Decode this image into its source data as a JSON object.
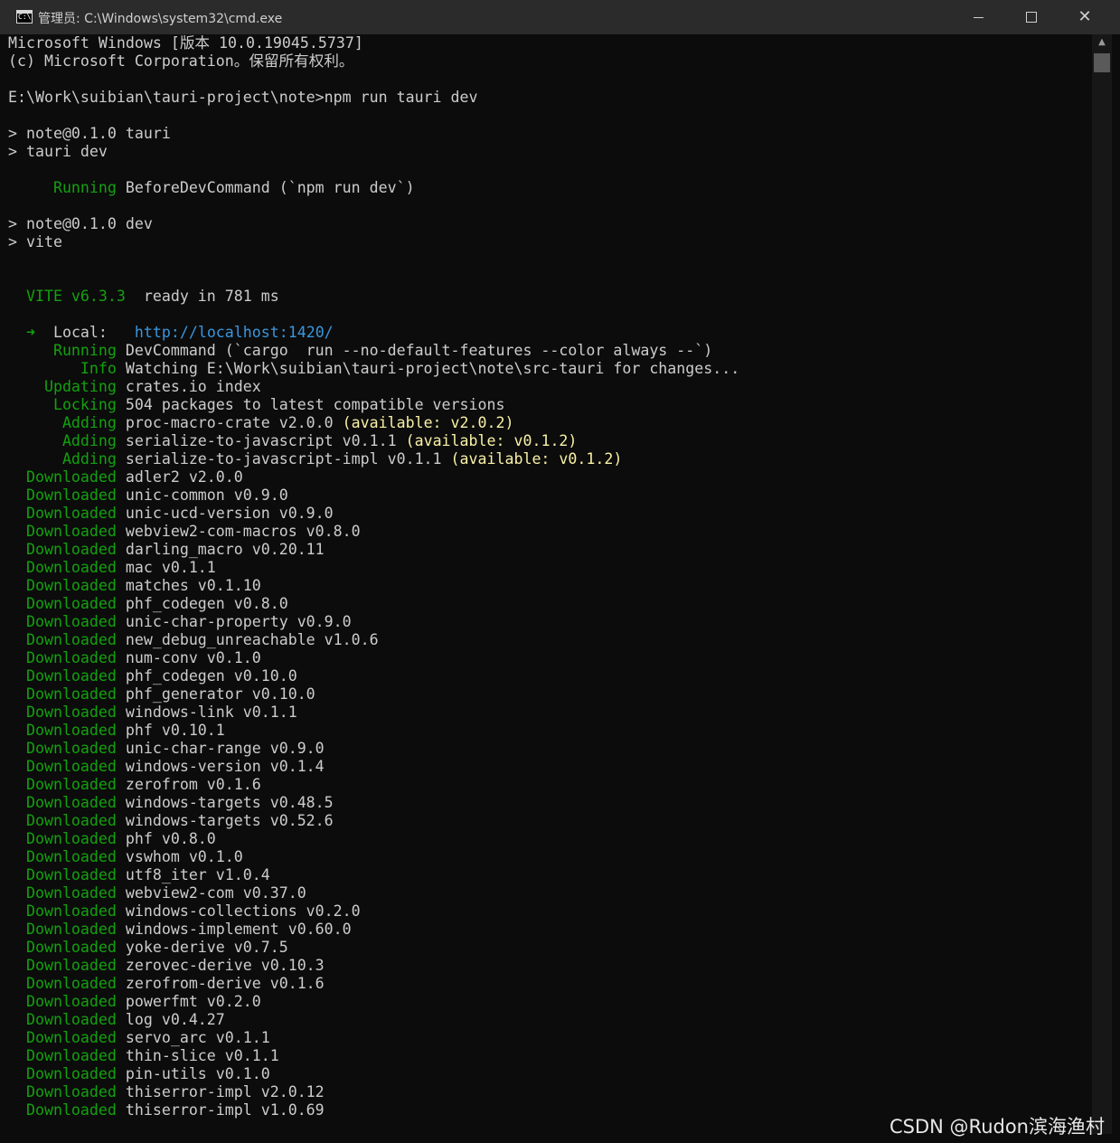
{
  "window": {
    "title": "管理员: C:\\Windows\\system32\\cmd.exe",
    "icon": "cmd-icon",
    "icon_glyph": "C:\\",
    "controls": {
      "minimize": "minimize-icon",
      "maximize": "maximize-icon",
      "close": "close-icon",
      "close_glyph": "✕"
    }
  },
  "colors": {
    "background": "#0c0c0c",
    "text": "#cccccc",
    "green": "#13a10e",
    "yellow": "#f9f1a5",
    "blue": "#3a96dd",
    "titlebar": "#2b2b2b"
  },
  "console": {
    "lines": [
      [
        {
          "t": "Microsoft Windows [版本 10.0.19045.5737]",
          "c": "w"
        }
      ],
      [
        {
          "t": "(c) Microsoft Corporation。保留所有权利。",
          "c": "w"
        }
      ],
      [],
      [
        {
          "t": "E:\\Work\\suibian\\tauri-project\\note>npm run tauri dev",
          "c": "w"
        }
      ],
      [],
      [
        {
          "t": "> note@0.1.0 tauri",
          "c": "w"
        }
      ],
      [
        {
          "t": "> tauri dev",
          "c": "w"
        }
      ],
      [],
      [
        {
          "t": "     Running",
          "c": "g"
        },
        {
          "t": " BeforeDevCommand (`npm run dev`)",
          "c": "w"
        }
      ],
      [],
      [
        {
          "t": "> note@0.1.0 dev",
          "c": "w"
        }
      ],
      [
        {
          "t": "> vite",
          "c": "w"
        }
      ],
      [],
      [],
      [
        {
          "t": "  VITE v6.3.3",
          "c": "g"
        },
        {
          "t": "  ready in ",
          "c": "w"
        },
        {
          "t": "781",
          "c": "w"
        },
        {
          "t": " ms",
          "c": "w"
        }
      ],
      [],
      [
        {
          "t": "  ➜",
          "c": "g"
        },
        {
          "t": "  Local:   ",
          "c": "w"
        },
        {
          "t": "http://localhost:1420/",
          "c": "b"
        }
      ],
      [
        {
          "t": "     Running",
          "c": "g"
        },
        {
          "t": " DevCommand (`cargo  run --no-default-features --color always --`)",
          "c": "w"
        }
      ],
      [
        {
          "t": "        Info",
          "c": "g"
        },
        {
          "t": " Watching E:\\Work\\suibian\\tauri-project\\note\\src-tauri for changes...",
          "c": "w"
        }
      ],
      [
        {
          "t": "    Updating",
          "c": "g"
        },
        {
          "t": " crates.io index",
          "c": "w"
        }
      ],
      [
        {
          "t": "     Locking",
          "c": "g"
        },
        {
          "t": " 504 packages to latest compatible versions",
          "c": "w"
        }
      ],
      [
        {
          "t": "      Adding",
          "c": "g"
        },
        {
          "t": " proc-macro-crate v2.0.0 ",
          "c": "w"
        },
        {
          "t": "(available: v2.0.2)",
          "c": "y"
        }
      ],
      [
        {
          "t": "      Adding",
          "c": "g"
        },
        {
          "t": " serialize-to-javascript v0.1.1 ",
          "c": "w"
        },
        {
          "t": "(available: v0.1.2)",
          "c": "y"
        }
      ],
      [
        {
          "t": "      Adding",
          "c": "g"
        },
        {
          "t": " serialize-to-javascript-impl v0.1.1 ",
          "c": "w"
        },
        {
          "t": "(available: v0.1.2)",
          "c": "y"
        }
      ],
      [
        {
          "t": "  Downloaded",
          "c": "g"
        },
        {
          "t": " adler2 v2.0.0",
          "c": "w"
        }
      ],
      [
        {
          "t": "  Downloaded",
          "c": "g"
        },
        {
          "t": " unic-common v0.9.0",
          "c": "w"
        }
      ],
      [
        {
          "t": "  Downloaded",
          "c": "g"
        },
        {
          "t": " unic-ucd-version v0.9.0",
          "c": "w"
        }
      ],
      [
        {
          "t": "  Downloaded",
          "c": "g"
        },
        {
          "t": " webview2-com-macros v0.8.0",
          "c": "w"
        }
      ],
      [
        {
          "t": "  Downloaded",
          "c": "g"
        },
        {
          "t": " darling_macro v0.20.11",
          "c": "w"
        }
      ],
      [
        {
          "t": "  Downloaded",
          "c": "g"
        },
        {
          "t": " mac v0.1.1",
          "c": "w"
        }
      ],
      [
        {
          "t": "  Downloaded",
          "c": "g"
        },
        {
          "t": " matches v0.1.10",
          "c": "w"
        }
      ],
      [
        {
          "t": "  Downloaded",
          "c": "g"
        },
        {
          "t": " phf_codegen v0.8.0",
          "c": "w"
        }
      ],
      [
        {
          "t": "  Downloaded",
          "c": "g"
        },
        {
          "t": " unic-char-property v0.9.0",
          "c": "w"
        }
      ],
      [
        {
          "t": "  Downloaded",
          "c": "g"
        },
        {
          "t": " new_debug_unreachable v1.0.6",
          "c": "w"
        }
      ],
      [
        {
          "t": "  Downloaded",
          "c": "g"
        },
        {
          "t": " num-conv v0.1.0",
          "c": "w"
        }
      ],
      [
        {
          "t": "  Downloaded",
          "c": "g"
        },
        {
          "t": " phf_codegen v0.10.0",
          "c": "w"
        }
      ],
      [
        {
          "t": "  Downloaded",
          "c": "g"
        },
        {
          "t": " phf_generator v0.10.0",
          "c": "w"
        }
      ],
      [
        {
          "t": "  Downloaded",
          "c": "g"
        },
        {
          "t": " windows-link v0.1.1",
          "c": "w"
        }
      ],
      [
        {
          "t": "  Downloaded",
          "c": "g"
        },
        {
          "t": " phf v0.10.1",
          "c": "w"
        }
      ],
      [
        {
          "t": "  Downloaded",
          "c": "g"
        },
        {
          "t": " unic-char-range v0.9.0",
          "c": "w"
        }
      ],
      [
        {
          "t": "  Downloaded",
          "c": "g"
        },
        {
          "t": " windows-version v0.1.4",
          "c": "w"
        }
      ],
      [
        {
          "t": "  Downloaded",
          "c": "g"
        },
        {
          "t": " zerofrom v0.1.6",
          "c": "w"
        }
      ],
      [
        {
          "t": "  Downloaded",
          "c": "g"
        },
        {
          "t": " windows-targets v0.48.5",
          "c": "w"
        }
      ],
      [
        {
          "t": "  Downloaded",
          "c": "g"
        },
        {
          "t": " windows-targets v0.52.6",
          "c": "w"
        }
      ],
      [
        {
          "t": "  Downloaded",
          "c": "g"
        },
        {
          "t": " phf v0.8.0",
          "c": "w"
        }
      ],
      [
        {
          "t": "  Downloaded",
          "c": "g"
        },
        {
          "t": " vswhom v0.1.0",
          "c": "w"
        }
      ],
      [
        {
          "t": "  Downloaded",
          "c": "g"
        },
        {
          "t": " utf8_iter v1.0.4",
          "c": "w"
        }
      ],
      [
        {
          "t": "  Downloaded",
          "c": "g"
        },
        {
          "t": " webview2-com v0.37.0",
          "c": "w"
        }
      ],
      [
        {
          "t": "  Downloaded",
          "c": "g"
        },
        {
          "t": " windows-collections v0.2.0",
          "c": "w"
        }
      ],
      [
        {
          "t": "  Downloaded",
          "c": "g"
        },
        {
          "t": " windows-implement v0.60.0",
          "c": "w"
        }
      ],
      [
        {
          "t": "  Downloaded",
          "c": "g"
        },
        {
          "t": " yoke-derive v0.7.5",
          "c": "w"
        }
      ],
      [
        {
          "t": "  Downloaded",
          "c": "g"
        },
        {
          "t": " zerovec-derive v0.10.3",
          "c": "w"
        }
      ],
      [
        {
          "t": "  Downloaded",
          "c": "g"
        },
        {
          "t": " zerofrom-derive v0.1.6",
          "c": "w"
        }
      ],
      [
        {
          "t": "  Downloaded",
          "c": "g"
        },
        {
          "t": " powerfmt v0.2.0",
          "c": "w"
        }
      ],
      [
        {
          "t": "  Downloaded",
          "c": "g"
        },
        {
          "t": " log v0.4.27",
          "c": "w"
        }
      ],
      [
        {
          "t": "  Downloaded",
          "c": "g"
        },
        {
          "t": " servo_arc v0.1.1",
          "c": "w"
        }
      ],
      [
        {
          "t": "  Downloaded",
          "c": "g"
        },
        {
          "t": " thin-slice v0.1.1",
          "c": "w"
        }
      ],
      [
        {
          "t": "  Downloaded",
          "c": "g"
        },
        {
          "t": " pin-utils v0.1.0",
          "c": "w"
        }
      ],
      [
        {
          "t": "  Downloaded",
          "c": "g"
        },
        {
          "t": " thiserror-impl v2.0.12",
          "c": "w"
        }
      ],
      [
        {
          "t": "  Downloaded",
          "c": "g"
        },
        {
          "t": " thiserror-impl v1.0.69",
          "c": "w"
        }
      ]
    ]
  },
  "scrollbar": {
    "up_glyph": "▲"
  },
  "watermark": "CSDN @Rudon滨海渔村"
}
